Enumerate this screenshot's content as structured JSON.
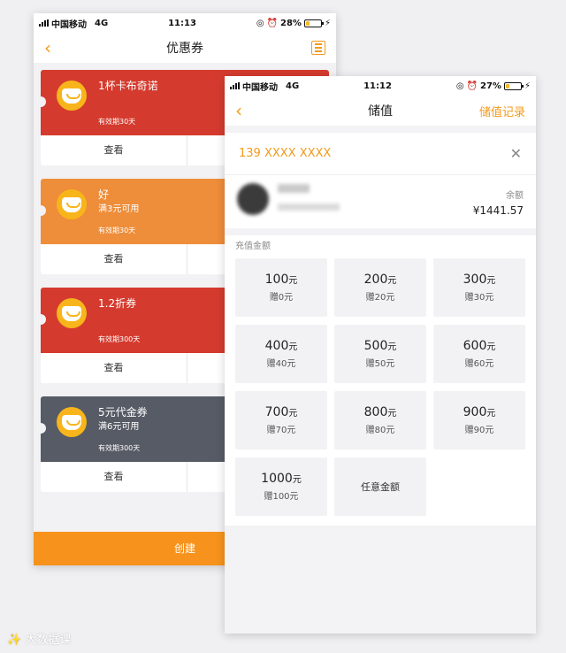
{
  "coupon_screen": {
    "status": {
      "carrier": "中国移动",
      "network": "4G",
      "time": "11:13",
      "battery": "28%",
      "battery_level": 0.28
    },
    "title": "优惠券",
    "coupons": [
      {
        "name": "1杯卡布奇诺",
        "condition": "",
        "validity": "有效期30天",
        "action": "查看",
        "color": "#d43b2e"
      },
      {
        "name": "好",
        "condition": "满3元可用",
        "validity": "有效期30天",
        "action": "查看",
        "color": "#ee8d3a"
      },
      {
        "name": "1.2折券",
        "condition": "",
        "validity": "有效期300天",
        "action": "查看",
        "color": "#d43b2e"
      },
      {
        "name": "5元代金券",
        "condition": "满6元可用",
        "validity": "有效期300天",
        "action": "查看",
        "color": "#575b66"
      }
    ],
    "create_label": "创建"
  },
  "topup_screen": {
    "status": {
      "carrier": "中国移动",
      "network": "4G",
      "time": "11:12",
      "battery": "27%",
      "battery_level": 0.27
    },
    "title": "储值",
    "record_label": "储值记录",
    "phone": "139 XXXX XXXX",
    "balance_label": "余额",
    "balance_value": "¥1441.57",
    "amount_label": "充值金额",
    "options": [
      {
        "amount": "100",
        "unit": "元",
        "gift": "赠0元"
      },
      {
        "amount": "200",
        "unit": "元",
        "gift": "赠20元"
      },
      {
        "amount": "300",
        "unit": "元",
        "gift": "赠30元"
      },
      {
        "amount": "400",
        "unit": "元",
        "gift": "赠40元"
      },
      {
        "amount": "500",
        "unit": "元",
        "gift": "赠50元"
      },
      {
        "amount": "600",
        "unit": "元",
        "gift": "赠60元"
      },
      {
        "amount": "700",
        "unit": "元",
        "gift": "赠70元"
      },
      {
        "amount": "800",
        "unit": "元",
        "gift": "赠80元"
      },
      {
        "amount": "900",
        "unit": "元",
        "gift": "赠90元"
      },
      {
        "amount": "1000",
        "unit": "元",
        "gift": "赠100元"
      }
    ],
    "custom_amount_label": "任意金额"
  },
  "watermark": "大数据课",
  "accent_color": "#f39a1a"
}
